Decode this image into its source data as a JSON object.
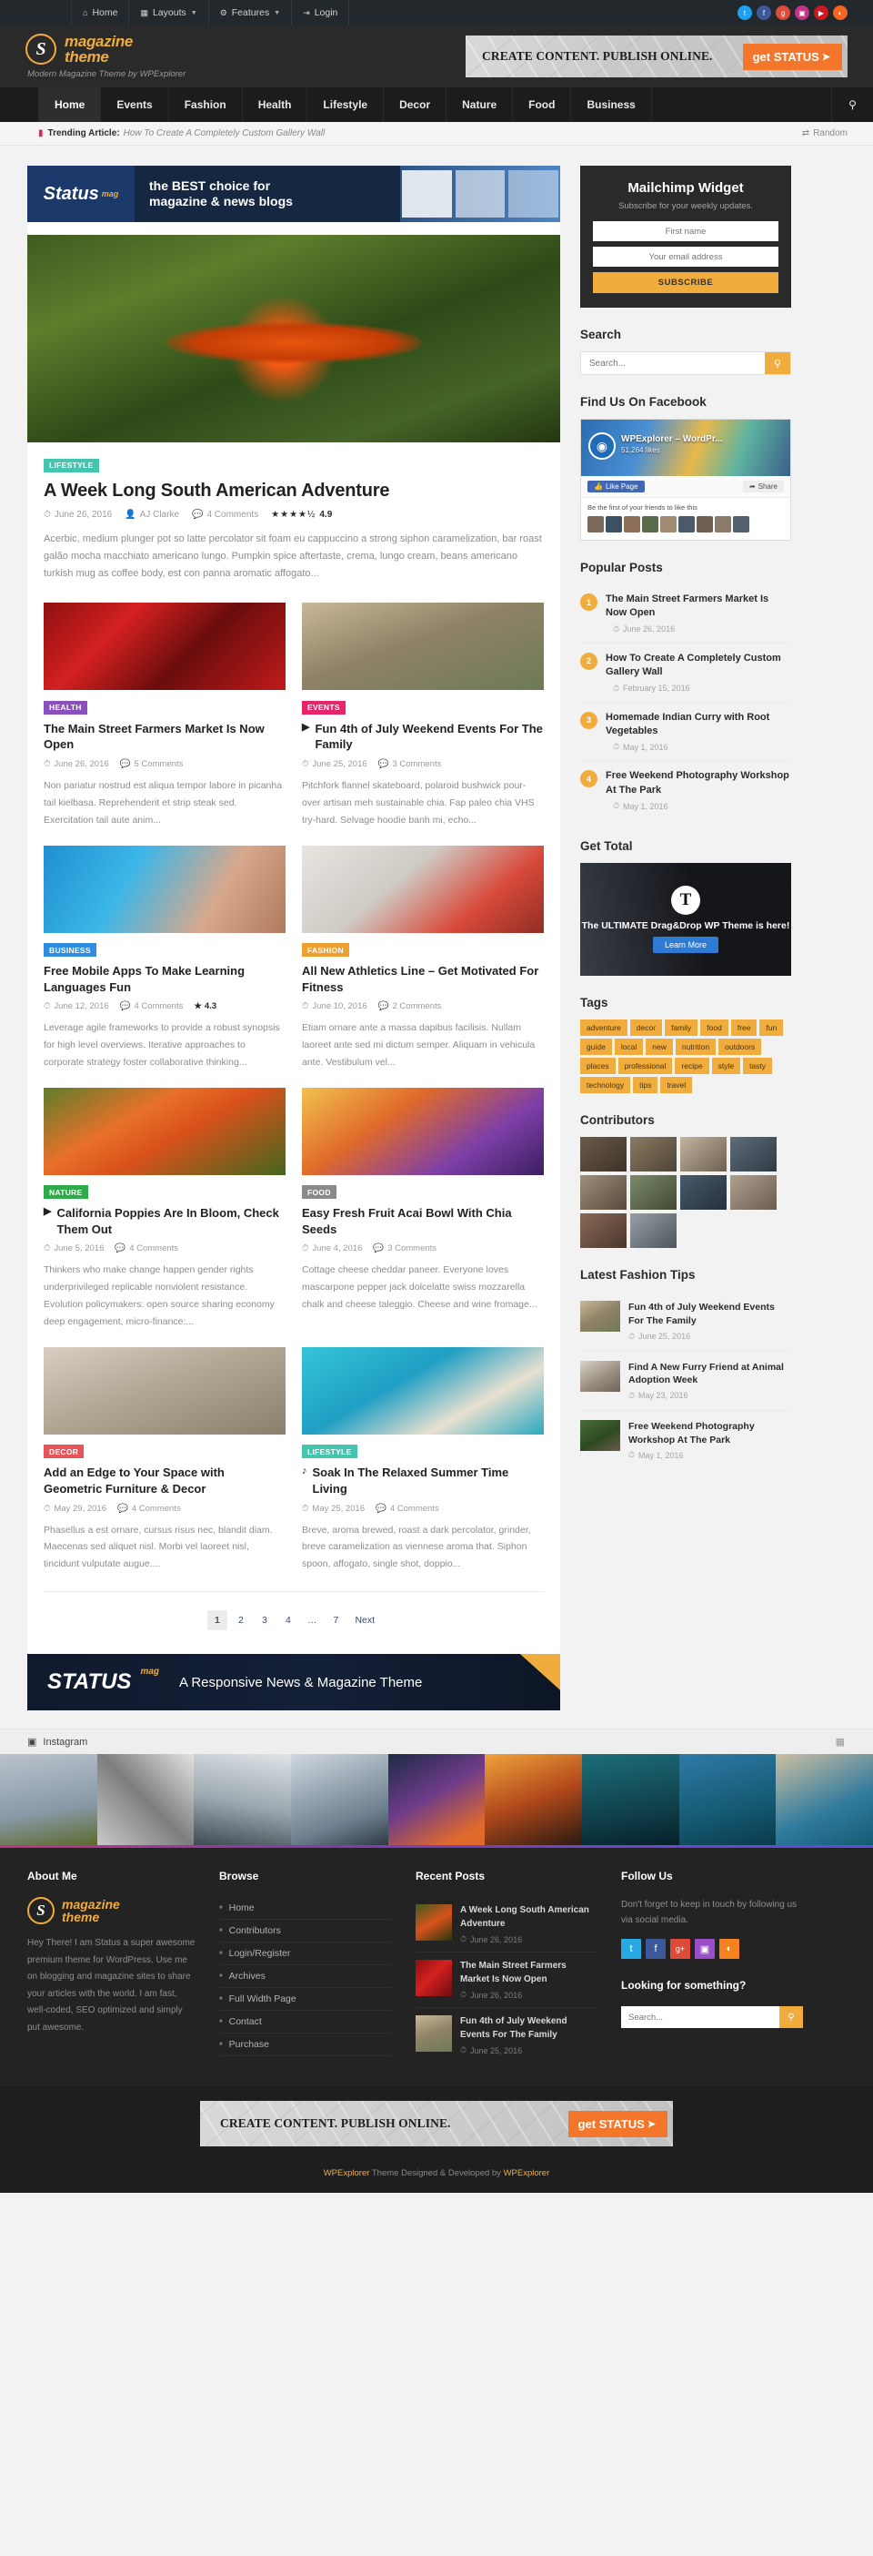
{
  "admin_bar": {
    "items": [
      {
        "icon": "home-icon",
        "label": "Home",
        "caret": false
      },
      {
        "icon": "layouts-icon",
        "label": "Layouts",
        "caret": true
      },
      {
        "icon": "gear-icon",
        "label": "Features",
        "caret": true
      },
      {
        "icon": "login-icon",
        "label": "Login",
        "caret": false
      }
    ],
    "social": [
      {
        "name": "twitter-icon",
        "glyph": "t",
        "color": "#1da1f2"
      },
      {
        "name": "facebook-icon",
        "glyph": "f",
        "color": "#3b5998"
      },
      {
        "name": "google-plus-icon",
        "glyph": "g",
        "color": "#dd4b39"
      },
      {
        "name": "instagram-icon",
        "glyph": "▣",
        "color": "#c13584"
      },
      {
        "name": "youtube-icon",
        "glyph": "▶",
        "color": "#cc181e"
      },
      {
        "name": "rss-icon",
        "glyph": "◔",
        "color": "#f26522"
      }
    ]
  },
  "header": {
    "logo_letter": "S",
    "logo_line1": "magazine",
    "logo_line2": "theme",
    "tagline": "Modern Magazine Theme by WPExplorer",
    "ad_text": "CREATE CONTENT. PUBLISH ONLINE.",
    "ad_button": "get STATUS",
    "ad_button_chev": "›"
  },
  "nav": {
    "items": [
      {
        "label": "Home",
        "active": true
      },
      {
        "label": "Events",
        "active": false
      },
      {
        "label": "Fashion",
        "active": false
      },
      {
        "label": "Health",
        "active": false
      },
      {
        "label": "Lifestyle",
        "active": false
      },
      {
        "label": "Decor",
        "active": false
      },
      {
        "label": "Nature",
        "active": false
      },
      {
        "label": "Food",
        "active": false
      },
      {
        "label": "Business",
        "active": false
      }
    ],
    "search_icon": "search-icon"
  },
  "trending": {
    "label": "Trending Article:",
    "title": "How To Create A Completely Custom Gallery Wall",
    "random": "Random"
  },
  "promo": {
    "brand": "Status",
    "brand_sup": "mag",
    "line1": "the BEST choice for",
    "line2": "magazine & news blogs"
  },
  "featured": {
    "category": "LIFESTYLE",
    "category_color": "#45c4b0",
    "title": "A Week Long South American Adventure",
    "date": "June 26, 2016",
    "author": "AJ Clarke",
    "comments": "4 Comments",
    "stars": "★★★★½",
    "rating": "4.9",
    "excerpt": "Acerbic, medium plunger pot so latte percolator sit foam eu cappuccino a strong siphon caramelization, bar roast galão mocha macchiato americano lungo. Pumpkin spice aftertaste, crema, lungo cream, beans americano turkish mug as coffee body, est con panna aromatic affogato..."
  },
  "posts": [
    {
      "category": "HEALTH",
      "category_color": "#8a4fbd",
      "title": "The Main Street Farmers Market Is Now Open",
      "format_icon": "",
      "date": "June 26, 2016",
      "comments": "5 Comments",
      "rating": "",
      "excerpt": "Non pariatur nostrud est aliqua tempor labore in picanha tail kielbasa. Reprehenderit et strip steak sed. Exercitation tail aute anim...",
      "thumb": "peppers"
    },
    {
      "category": "EVENTS",
      "category_color": "#e8246c",
      "title": "Fun 4th of July Weekend Events For The Family",
      "format_icon": "video-icon",
      "date": "June 25, 2016",
      "comments": "3 Comments",
      "rating": "",
      "excerpt": "Pitchfork flannel skateboard, polaroid bushwick pour-over artisan meh sustainable chia. Fap paleo chia VHS try-hard. Selvage hoodie banh mi, echo...",
      "thumb": "girl-field"
    },
    {
      "category": "BUSINESS",
      "category_color": "#2f8ee0",
      "title": "Free Mobile Apps To Make Learning Languages Fun",
      "format_icon": "",
      "date": "June 12, 2016",
      "comments": "4 Comments",
      "rating": "4.3",
      "excerpt": "Leverage agile frameworks to provide a robust synopsis for high level overviews. Iterative approaches to corporate strategy foster collaborative thinking...",
      "thumb": "woman-pool"
    },
    {
      "category": "FASHION",
      "category_color": "#f0a030",
      "title": "All New Athletics Line – Get Motivated For Fitness",
      "format_icon": "",
      "date": "June 10, 2016",
      "comments": "2 Comments",
      "rating": "",
      "excerpt": "Etiam ornare ante a massa dapibus facilisis. Nullam laoreet ante sed mi dictum semper. Aliquam in vehicula ante. Vestibulum vel...",
      "thumb": "sneakers"
    },
    {
      "category": "NATURE",
      "category_color": "#2eaa4a",
      "title": "California Poppies Are In Bloom, Check Them Out",
      "format_icon": "video-icon",
      "date": "June 5, 2016",
      "comments": "4 Comments",
      "rating": "",
      "excerpt": "Thinkers who make change happen gender rights underprivileged replicable nonviolent resistance. Evolution policymakers: open source sharing economy deep engagement, micro-finance:...",
      "thumb": "poppies"
    },
    {
      "category": "FOOD",
      "category_color": "#8a8a8a",
      "title": "Easy Fresh Fruit Acai Bowl With Chia Seeds",
      "format_icon": "",
      "date": "June 4, 2016",
      "comments": "3 Comments",
      "rating": "",
      "excerpt": "Cottage cheese cheddar paneer. Everyone loves mascarpone pepper jack dolcelatte swiss mozzarella chalk and cheese taleggio. Cheese and wine fromage...",
      "thumb": "acai"
    },
    {
      "category": "DECOR",
      "category_color": "#e8545a",
      "title": "Add an Edge to Your Space with Geometric Furniture & Decor",
      "format_icon": "",
      "date": "May 29, 2016",
      "comments": "4 Comments",
      "rating": "",
      "excerpt": "Phasellus a est ornare, cursus risus nec, blandit diam. Maecenas sed aliquet nisl. Morbi vel laoreet nisl, tincidunt vulputate augue....",
      "thumb": "desk"
    },
    {
      "category": "LIFESTYLE",
      "category_color": "#45c4b0",
      "title": "Soak In The Relaxed Summer Time Living",
      "format_icon": "audio-icon",
      "date": "May 25, 2016",
      "comments": "4 Comments",
      "rating": "",
      "excerpt": "Breve, aroma brewed, roast a dark percolator, grinder, breve caramelization as viennese aroma that. Siphon spoon, affogato, single shot, doppio...",
      "thumb": "pool-float"
    }
  ],
  "pagination": {
    "pages": [
      "1",
      "2",
      "3",
      "4",
      "…",
      "7"
    ],
    "next": "Next",
    "active": "1"
  },
  "content_ad": {
    "brand": "STATUS",
    "brand_sup": "mag",
    "tagline": "A Responsive News & Magazine Theme"
  },
  "sidebar": {
    "mailchimp": {
      "title": "Mailchimp Widget",
      "subtitle": "Subscribe for your weekly updates.",
      "first_name_placeholder": "First name",
      "email_placeholder": "Your email address",
      "button": "SUBSCRIBE"
    },
    "search": {
      "title": "Search",
      "placeholder": "Search...",
      "icon": "search-icon"
    },
    "facebook": {
      "title": "Find Us On Facebook",
      "page_name": "WPExplorer – WordPr...",
      "page_likes": "51,264 likes",
      "like_label": "Like Page",
      "share_label": "Share",
      "friends_text": "Be the first of your friends to like this"
    },
    "popular": {
      "title": "Popular Posts",
      "items": [
        {
          "num": "1",
          "title": "The Main Street Farmers Market Is Now Open",
          "date": "June 26, 2016"
        },
        {
          "num": "2",
          "title": "How To Create A Completely Custom Gallery Wall",
          "date": "February 15, 2016"
        },
        {
          "num": "3",
          "title": "Homemade Indian Curry with Root Vegetables",
          "date": "May 1, 2016"
        },
        {
          "num": "4",
          "title": "Free Weekend Photography Workshop At The Park",
          "date": "May 1, 2016"
        }
      ]
    },
    "gettotal": {
      "title": "Get Total",
      "logo_letter": "T",
      "text": "The ULTIMATE Drag&Drop WP Theme is here!",
      "button": "Learn More"
    },
    "tags": {
      "title": "Tags",
      "items": [
        "adventure",
        "decor",
        "family",
        "food",
        "free",
        "fun",
        "guide",
        "local",
        "new",
        "nutrition",
        "outdoors",
        "places",
        "professional",
        "recipe",
        "style",
        "tasty",
        "technology",
        "tips",
        "travel"
      ]
    },
    "contributors": {
      "title": "Contributors",
      "count": 10
    },
    "latest_fashion": {
      "title": "Latest Fashion Tips",
      "items": [
        {
          "title": "Fun 4th of July Weekend Events For The Family",
          "date": "June 25, 2016"
        },
        {
          "title": "Find A New Furry Friend at Animal Adoption Week",
          "date": "May 23, 2016"
        },
        {
          "title": "Free Weekend Photography Workshop At The Park",
          "date": "May 1, 2016"
        }
      ]
    }
  },
  "instagram": {
    "label": "Instagram",
    "icon": "instagram-icon",
    "grid_icon": "grid-icon"
  },
  "footer": {
    "about": {
      "title": "About Me",
      "logo_letter": "S",
      "logo_line1": "magazine",
      "logo_line2": "theme",
      "text": "Hey There! I am Status a super awesome premium theme for WordPress. Use me on blogging and magazine sites to share your articles with the world. I am fast, well-coded, SEO optimized and simply put awesome."
    },
    "browse": {
      "title": "Browse",
      "links": [
        "Home",
        "Contributors",
        "Login/Register",
        "Archives",
        "Full Width Page",
        "Contact",
        "Purchase"
      ]
    },
    "recent": {
      "title": "Recent Posts",
      "items": [
        {
          "title": "A Week Long South American Adventure",
          "date": "June 26, 2016"
        },
        {
          "title": "The Main Street Farmers Market Is Now Open",
          "date": "June 26, 2016"
        },
        {
          "title": "Fun 4th of July Weekend Events For The Family",
          "date": "June 25, 2016"
        }
      ]
    },
    "follow": {
      "title": "Follow Us",
      "text": "Don't forget to keep in touch by following us via social media.",
      "socials": [
        {
          "name": "twitter-icon",
          "glyph": "t",
          "color": "#29a9e1"
        },
        {
          "name": "facebook-icon",
          "glyph": "f",
          "color": "#3b5998"
        },
        {
          "name": "google-plus-icon",
          "glyph": "g+",
          "color": "#dd4b39"
        },
        {
          "name": "instagram-icon",
          "glyph": "▣",
          "color": "#9b4ec9"
        },
        {
          "name": "rss-icon",
          "glyph": "◔",
          "color": "#f58220"
        }
      ],
      "search_title": "Looking for something?",
      "search_placeholder": "Search...",
      "search_icon": "search-icon"
    }
  },
  "bottom_ad": {
    "text": "CREATE CONTENT. PUBLISH ONLINE.",
    "button": "get STATUS",
    "chev": "›"
  },
  "copyright": {
    "prefix": "WPExplorer",
    "text": " Theme Designed & Developed by ",
    "suffix": "WPExplorer"
  }
}
